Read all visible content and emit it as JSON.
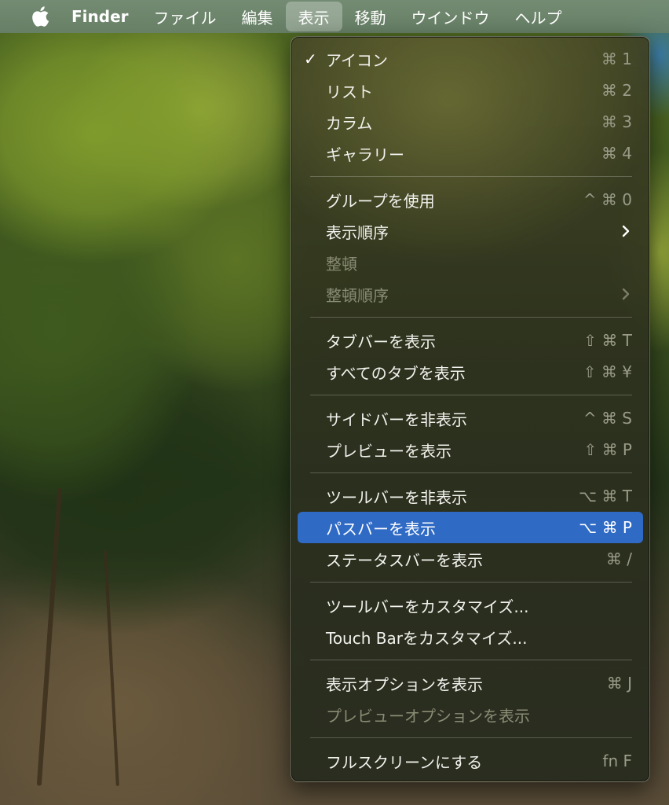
{
  "menubar": {
    "app_name": "Finder",
    "items": [
      "ファイル",
      "編集",
      "表示",
      "移動",
      "ウインドウ",
      "ヘルプ"
    ]
  },
  "menu": {
    "items": [
      {
        "label": "アイコン",
        "shortcut": "⌘ 1",
        "checked": true
      },
      {
        "label": "リスト",
        "shortcut": "⌘ 2"
      },
      {
        "label": "カラム",
        "shortcut": "⌘ 3"
      },
      {
        "label": "ギャラリー",
        "shortcut": "⌘ 4"
      },
      {
        "label": "グループを使用",
        "shortcut": "^ ⌘ 0"
      },
      {
        "label": "表示順序",
        "submenu": true
      },
      {
        "label": "整頓",
        "disabled": true
      },
      {
        "label": "整頓順序",
        "submenu": true,
        "disabled": true
      },
      {
        "label": "タブバーを表示",
        "shortcut": "⇧ ⌘ T"
      },
      {
        "label": "すべてのタブを表示",
        "shortcut": "⇧ ⌘ ¥"
      },
      {
        "label": "サイドバーを非表示",
        "shortcut": "^ ⌘ S"
      },
      {
        "label": "プレビューを表示",
        "shortcut": "⇧ ⌘ P"
      },
      {
        "label": "ツールバーを非表示",
        "shortcut": "⌥ ⌘ T"
      },
      {
        "label": "パスバーを表示",
        "shortcut": "⌥ ⌘ P",
        "highlighted": true
      },
      {
        "label": "ステータスバーを表示",
        "shortcut": "⌘ /"
      },
      {
        "label": "ツールバーをカスタマイズ..."
      },
      {
        "label": "Touch Barをカスタマイズ..."
      },
      {
        "label": "表示オプションを表示",
        "shortcut": "⌘ J"
      },
      {
        "label": "プレビューオプションを表示",
        "disabled": true
      },
      {
        "label": "フルスクリーンにする",
        "shortcut": "fn F"
      }
    ]
  },
  "colors": {
    "highlight": "#2f6ac5",
    "menubar": "#74917a"
  }
}
